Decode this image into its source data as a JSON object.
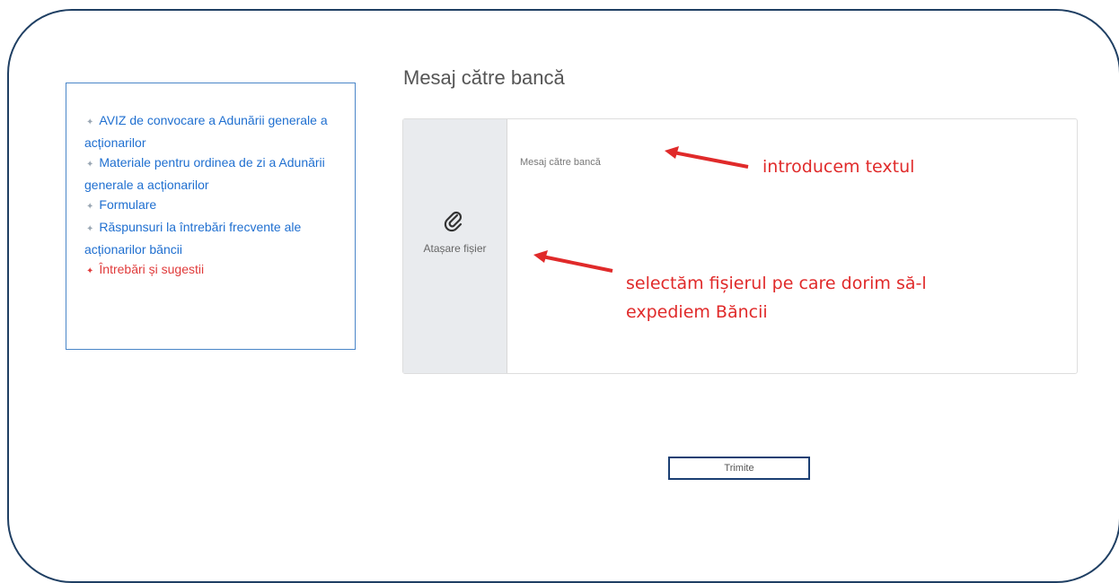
{
  "sidebar": {
    "items": [
      {
        "label": "AVIZ de convocare a Adunării generale a acționarilor"
      },
      {
        "label": "Materiale pentru ordinea de zi a Adunării generale a acționarilor"
      },
      {
        "label": "Formulare"
      },
      {
        "label": "Răspunsuri la întrebări frecvente ale acționarilor băncii"
      },
      {
        "label": "Întrebări și sugestii"
      }
    ]
  },
  "main": {
    "title": "Mesaj către bancă",
    "attach_label": "Atașare fișier",
    "message_placeholder": "Mesaj către bancă",
    "submit_label": "Trimite"
  },
  "annotations": {
    "text_hint": "introducem textul",
    "file_hint_line1": "selectăm fișierul pe care dorim să-l",
    "file_hint_line2": "expediem Băncii"
  },
  "colors": {
    "link": "#1f6fd0",
    "active_link": "#e03b3b",
    "annotation": "#e02a2a",
    "frame": "#1f3f63"
  }
}
